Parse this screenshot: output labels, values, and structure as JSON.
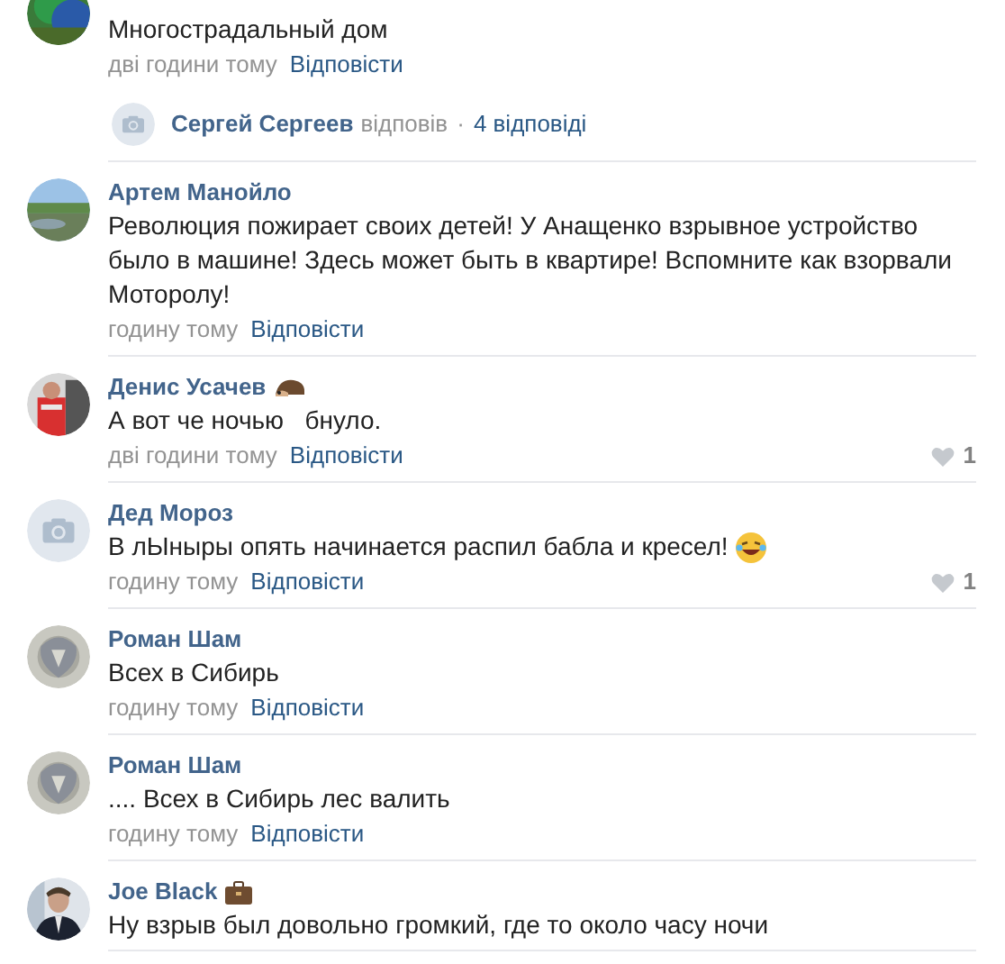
{
  "comments": [
    {
      "text": "Многострадальный дом",
      "time": "дві години тому",
      "reply": "Відповісти",
      "thread": {
        "author": "Сергей Сергеев",
        "action": "відповів",
        "separator": "·",
        "count": "4 відповіді"
      }
    },
    {
      "author": "Артем Манойло",
      "text": "Революция пожирает своих детей! У Анащенко взрывное устройство было в машине! Здесь может быть в квартире! Вспомните как взорвали Моторолу!",
      "time": "годину тому",
      "reply": "Відповісти"
    },
    {
      "author": "Денис Усачев",
      "badge": {
        "kind": "hedgehog"
      },
      "text": "А вот че ночью   бнуло.",
      "time": "дві години тому",
      "reply": "Відповісти",
      "likes": "1"
    },
    {
      "author": "Дед Мороз",
      "avatar": {
        "kind": "placeholder"
      },
      "text": "В лЫныры опять начинается распил бабла и кресел!",
      "emoji": {
        "kind": "laughing"
      },
      "time": "годину тому",
      "reply": "Відповісти",
      "likes": "1"
    },
    {
      "author": "Роман Шам",
      "text": "Всех в Сибирь",
      "time": "годину тому",
      "reply": "Відповісти"
    },
    {
      "author": "Роман Шам",
      "text": ".... Всех в Сибирь лес валить",
      "time": "годину тому",
      "reply": "Відповісти"
    },
    {
      "author": "Joe Black",
      "badge": {
        "kind": "briefcase"
      },
      "text": "Ну взрыв был довольно громкий, где то около часу ночи"
    }
  ]
}
